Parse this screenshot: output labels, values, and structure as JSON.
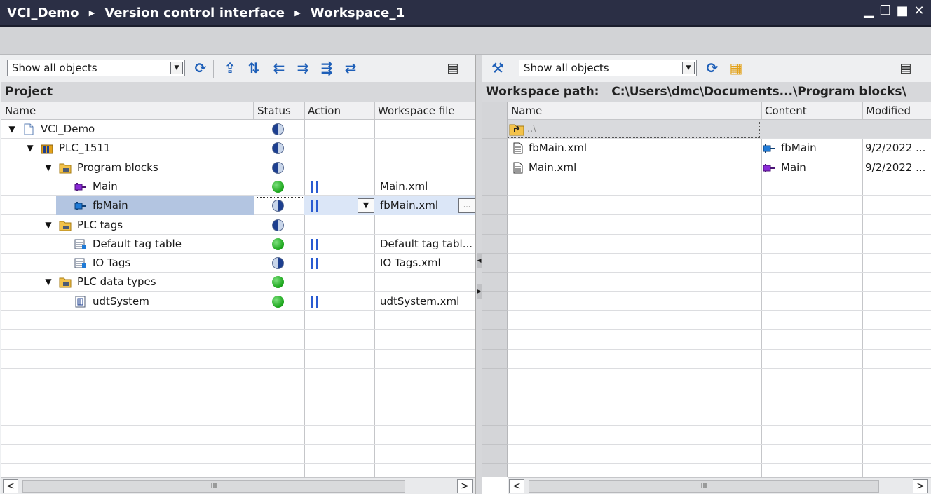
{
  "title": {
    "crumbs": [
      "VCI_Demo",
      "Version control interface",
      "Workspace_1"
    ],
    "controls": [
      "minimize-icon",
      "restore-icon",
      "maximize-icon",
      "close-icon"
    ]
  },
  "left": {
    "filter": "Show all objects",
    "section_title": "Project",
    "columns": [
      "Name",
      "Status",
      "Action",
      "Workspace file"
    ],
    "rows": [
      {
        "name": "VCI_Demo",
        "level": 0,
        "expanded": true,
        "icon": "project-icon",
        "status": "half",
        "action": "",
        "file": ""
      },
      {
        "name": "PLC_1511",
        "level": 1,
        "expanded": true,
        "icon": "plc-icon",
        "status": "half",
        "action": "",
        "file": ""
      },
      {
        "name": "Program blocks",
        "level": 2,
        "expanded": true,
        "icon": "folder-icon",
        "status": "half",
        "action": "",
        "file": ""
      },
      {
        "name": "Main",
        "level": 3,
        "expanded": null,
        "icon": "ob-block-icon",
        "status": "green",
        "action": "pause",
        "file": "Main.xml"
      },
      {
        "name": "fbMain",
        "level": 3,
        "expanded": null,
        "icon": "fb-block-icon",
        "status": "modified",
        "action": "pause",
        "file": "fbMain.xml",
        "selected": true
      },
      {
        "name": "PLC tags",
        "level": 2,
        "expanded": true,
        "icon": "folder-icon",
        "status": "half",
        "action": "",
        "file": ""
      },
      {
        "name": "Default tag table",
        "level": 3,
        "expanded": null,
        "icon": "tag-table-icon",
        "status": "green",
        "action": "pause",
        "file": "Default tag tabl..."
      },
      {
        "name": "IO Tags",
        "level": 3,
        "expanded": null,
        "icon": "tag-table-icon",
        "status": "modified",
        "action": "pause",
        "file": "IO Tags.xml"
      },
      {
        "name": "PLC data types",
        "level": 2,
        "expanded": true,
        "icon": "folder-icon",
        "status": "green",
        "action": "",
        "file": ""
      },
      {
        "name": "udtSystem",
        "level": 3,
        "expanded": null,
        "icon": "udt-icon",
        "status": "green",
        "action": "pause",
        "file": "udtSystem.xml"
      }
    ],
    "scroll_thumb": "III"
  },
  "right": {
    "filter": "Show all objects",
    "workspace_label": "Workspace path:",
    "workspace_path": "C:\\Users\\dmc\\Documents...\\Program blocks\\",
    "columns": [
      "Name",
      "Content",
      "Modified"
    ],
    "parent_row": "..\\",
    "rows": [
      {
        "name": "fbMain.xml",
        "content": "fbMain",
        "content_icon": "fb-block-icon",
        "modified": "9/2/2022 ..."
      },
      {
        "name": "Main.xml",
        "content": "Main",
        "content_icon": "ob-block-icon",
        "modified": "9/2/2022 ..."
      }
    ],
    "scroll_thumb": "III"
  },
  "colors": {
    "titlebar": "#2b2f45",
    "selection": "#b3c5e1",
    "accent_blue": "#1e5fb8",
    "status_green": "#1ea81e"
  }
}
